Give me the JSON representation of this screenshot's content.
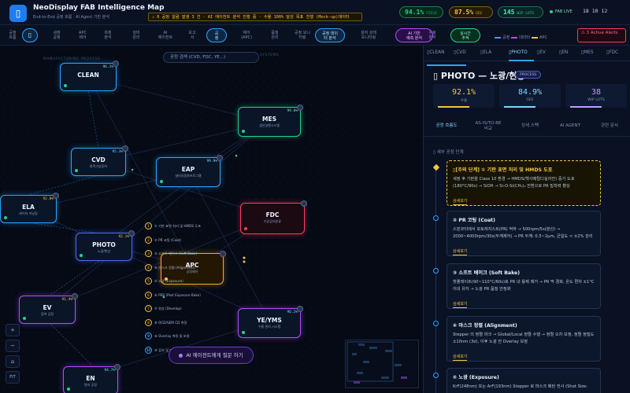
{
  "app": {
    "title": "NeoDisplay FAB Intelligence Map",
    "subtitle": "End-to-End 공정 흐름 · AI Agent 기반 분석",
    "logo_glyph": "▯",
    "ticker": "⚠ 0 공정 알람 발생 3 건 · AI 에이전트 분석 진행 중 · 수율 100% 달성 목표 진행 (Mock-up)데이터"
  },
  "kpis": [
    {
      "value": "94.1%",
      "label": "YIELD",
      "color": "#22d38a",
      "bg": "#06281a",
      "border": "#1f7a55"
    },
    {
      "value": "87.5%",
      "label": "OEE",
      "color": "#f5c542",
      "bg": "#231b04",
      "border": "#7a6214"
    },
    {
      "value": "145",
      "label": "WIP LOTS",
      "color": "#5ce6c8",
      "bg": "#062523",
      "border": "#1f6e62"
    }
  ],
  "status": {
    "live": "FAB LIVE",
    "clock": "18 10 12"
  },
  "steps": [
    {
      "label": "공정\n흐름",
      "kind": "plain"
    },
    {
      "label": "▯",
      "kind": "circ"
    },
    {
      "label": "세정\n공정",
      "kind": "plain"
    },
    {
      "label": "APC\n제어",
      "kind": "plain"
    },
    {
      "label": "측정\n분석",
      "kind": "plain"
    },
    {
      "label": "설비\n관리",
      "kind": "plain"
    },
    {
      "label": "AI\n에이전트",
      "kind": "plain"
    },
    {
      "label": "보고\n서",
      "kind": "plain"
    },
    {
      "label": "공\n정",
      "kind": "pill"
    },
    {
      "label": "제어\n(APC)",
      "kind": "plain"
    },
    {
      "label": "품질\n관리",
      "kind": "plain"
    },
    {
      "label": "공정 모니\n터링",
      "kind": "plain"
    },
    {
      "label": "공정 데이\n터 분석",
      "kind": "pill"
    },
    {
      "label": "설비 상태\n모니터링",
      "kind": "plain"
    },
    {
      "label": "AI 기반\n예측 분석",
      "kind": "mag"
    },
    {
      "label": "수율\n분석",
      "kind": "plain"
    },
    {
      "label": "실시간\n추적",
      "kind": "grn"
    }
  ],
  "legend": [
    {
      "label": "공정",
      "color": "#2ea4ff"
    },
    {
      "label": "데이터",
      "color": "#b14dff"
    },
    {
      "label": "APC",
      "color": "#f5c542"
    }
  ],
  "alerts": {
    "label": "⚠ 3 Active Alerts"
  },
  "map": {
    "search_placeholder": "공정 검색 (CVD, FDC, YE...)",
    "section_label": "MANUFACTURING PROCESS",
    "section_label_right": "SYSTEMS",
    "nodes": [
      {
        "name": "CLEAN",
        "sub": "",
        "pct": "96.1%",
        "color": "#2ea4ff",
        "pcolor": "#7ed7ff",
        "dot": "#22d38a"
      },
      {
        "name": "CVD",
        "sub": "화학기상증착",
        "pct": "95.3%",
        "color": "#2ea4ff",
        "pcolor": "#7ed7ff",
        "dot": "#22d38a"
      },
      {
        "name": "ELA",
        "sub": "레이저 어닐링",
        "pct": "92.8%",
        "color": "#2ea4ff",
        "pcolor": "#f5c542",
        "dot": "#22d38a"
      },
      {
        "name": "PHOTO",
        "sub": "노광/현상",
        "pct": "92.1%",
        "color": "#4f6bff",
        "pcolor": "#f5c542",
        "dot": "#22d38a"
      },
      {
        "name": "EV",
        "sub": "증착 공정",
        "pct": "91.4%",
        "color": "#b14dff",
        "pcolor": "#f5c542",
        "dot": "#22d38a"
      },
      {
        "name": "EN",
        "sub": "봉지 공정",
        "pct": "94.7%",
        "color": "#b14dff",
        "pcolor": "#7ed7ff",
        "dot": "#22d38a"
      },
      {
        "name": "EAP",
        "sub": "설비자동화프로그램",
        "pct": "99.9%",
        "color": "#2ea4ff",
        "pcolor": "#7ed7ff",
        "dot": "#22d38a"
      },
      {
        "name": "MES",
        "sub": "생산실행시스템",
        "pct": "99.8%",
        "color": "#22d38a",
        "pcolor": "#7ee2b0",
        "dot": "#22d38a"
      },
      {
        "name": "FDC",
        "sub": "이상감지분류",
        "pct": "",
        "color": "#ff3b5c",
        "pcolor": "#ff6b84",
        "dot": "#ff3b5c"
      },
      {
        "name": "APC",
        "sub": "공정제어",
        "pct": "",
        "color": "#f5a623",
        "pcolor": "#f5c542",
        "dot": "#f5c542"
      },
      {
        "name": "YE/YMS",
        "sub": "수율 관리 시스템",
        "pct": "96.2%",
        "color": "#b14dff",
        "pcolor": "#7ed7ff",
        "dot": "#22d38a"
      }
    ],
    "substeps": [
      {
        "num": "1",
        "label": "① 기판 표면 처리 및 HMDS 도포"
      },
      {
        "num": "2",
        "label": "② PR 코팅 (Coat)"
      },
      {
        "num": "3",
        "label": "③ 소프트 베이크 (Soft Bake)"
      },
      {
        "num": "4",
        "label": "④ 마스크 정렬 (Alignment)"
      },
      {
        "num": "5",
        "label": "⑤ 노광 (Exposure)"
      },
      {
        "num": "6",
        "label": "⑥ PEB (Post Exposure Bake)"
      },
      {
        "num": "7",
        "label": "⑦ 현상 (Develop)"
      },
      {
        "num": "8",
        "label": "⑧ OCD/SEM CD 측정"
      },
      {
        "num": "9",
        "label": "⑨ Overlay 측정 및 보정"
      },
      {
        "num": "10",
        "label": "⑩ 검사 및 판정"
      }
    ],
    "zoom": [
      "+",
      "−",
      "⌂",
      "FIT"
    ],
    "ai_button": "AI 에이전트에게 질문 하기"
  },
  "panel": {
    "tabs": [
      "▯CLEAN",
      "▯CVD",
      "▯ELA",
      "▯PHOTO",
      "▯EV",
      "▯EN",
      "▯MES",
      "▯FDC"
    ],
    "active_tab": 3,
    "title": "▯ PHOTO — 노광/현상",
    "badge": "PROCESS",
    "metrics": [
      {
        "value": "92.1%",
        "label": "수율",
        "color": "#f5c542"
      },
      {
        "value": "84.9%",
        "label": "OEE",
        "color": "#7ed7ff"
      },
      {
        "value": "38",
        "label": "WIP LOTS",
        "color": "#c29bff"
      }
    ],
    "subtabs": [
      "공정 흐름도",
      "AS-IS/TO-BE\n비교",
      "상세 스펙",
      "AI AGENT",
      "관련 문서"
    ],
    "section_heading": "▯ 세부 공정 단계",
    "cards": [
      {
        "title": "▯[주의 단계] ① 기판 표면 처리 및 HMDS 도포",
        "desc": "세정 후 기판을 Class 10 환경 → HMDS(헥사메틸디실라잔) 증기 도포 (180°C/90s) → SiOH → Si-O-Si(CH₃)₃ 전환으로 PR 밀착력 향상",
        "link": "상세보기",
        "warn": true
      },
      {
        "title": "② PR 코팅 (Coat)",
        "desc": "스핀코터에서 포토레지스트(PR) 적하 → 500rpm/5s(분산) → 2000~4000rpm/30s(두께제어) → PR 두께: 0.5~2μm, 균일도 < ±2% 관리",
        "link": "상세보기",
        "warn": false
      },
      {
        "title": "③ 소프트 베이크 (Soft Bake)",
        "desc": "핫플레이트(90~110°C/60s)로 PR 내 용제 제거 → PR 막 경화, 온도 편차 ±1°C 이내 유지 → 노광 PR 품질 안정화",
        "link": "상세보기",
        "warn": false
      },
      {
        "title": "④ 마스크 정렬 (Alignment)",
        "desc": "Stepper 의 정렬 마크 → Global/Local 정렬 수행 → 정렬 오차 보정, 정렬 정밀도 ±10nm (3σ), 이후 노광 전 Overlay 보정",
        "link": "상세보기",
        "warn": false
      },
      {
        "title": "⑤ 노광 (Exposure)",
        "desc": "KrF(248nm) 또는 ArF(193nm) Stepper 로 마스크 패턴 전사 (Shot Size:",
        "link": "",
        "warn": false
      }
    ]
  }
}
